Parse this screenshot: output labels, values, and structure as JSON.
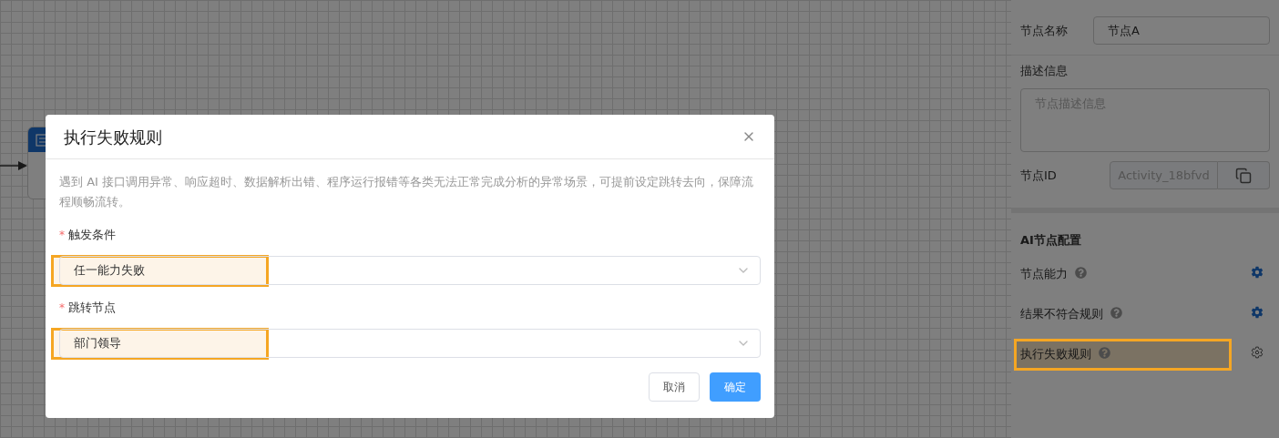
{
  "dialog": {
    "title": "执行失败规则",
    "description": "遇到 AI 接口调用异常、响应超时、数据解析出错、程序运行报错等各类无法正常完成分析的异常场景，可提前设定跳转去向，保障流程顺畅流转。",
    "fields": [
      {
        "label": "触发条件",
        "required": true,
        "required_mark": "*",
        "value": "任一能力失败",
        "highlighted": true
      },
      {
        "label": "跳转节点",
        "required": true,
        "required_mark": "*",
        "value": "部门领导",
        "highlighted": true
      }
    ],
    "buttons": [
      {
        "label": "取消",
        "kind": "default"
      },
      {
        "label": "确定",
        "kind": "primary"
      }
    ]
  },
  "properties_panel": {
    "name_label": "节点名称",
    "name_value": "节点A",
    "description_label": "描述信息",
    "description_placeholder": "节点描述信息",
    "id_label": "节点ID",
    "id_value": "Activity_18bfvd",
    "ai_section_title": "AI节点配置",
    "ai_rows": [
      {
        "label": "节点能力",
        "configured": true,
        "highlighted": false
      },
      {
        "label": "结果不符合规则",
        "configured": true,
        "highlighted": false
      },
      {
        "label": "执行失败规则",
        "configured": false,
        "highlighted": true
      }
    ]
  }
}
